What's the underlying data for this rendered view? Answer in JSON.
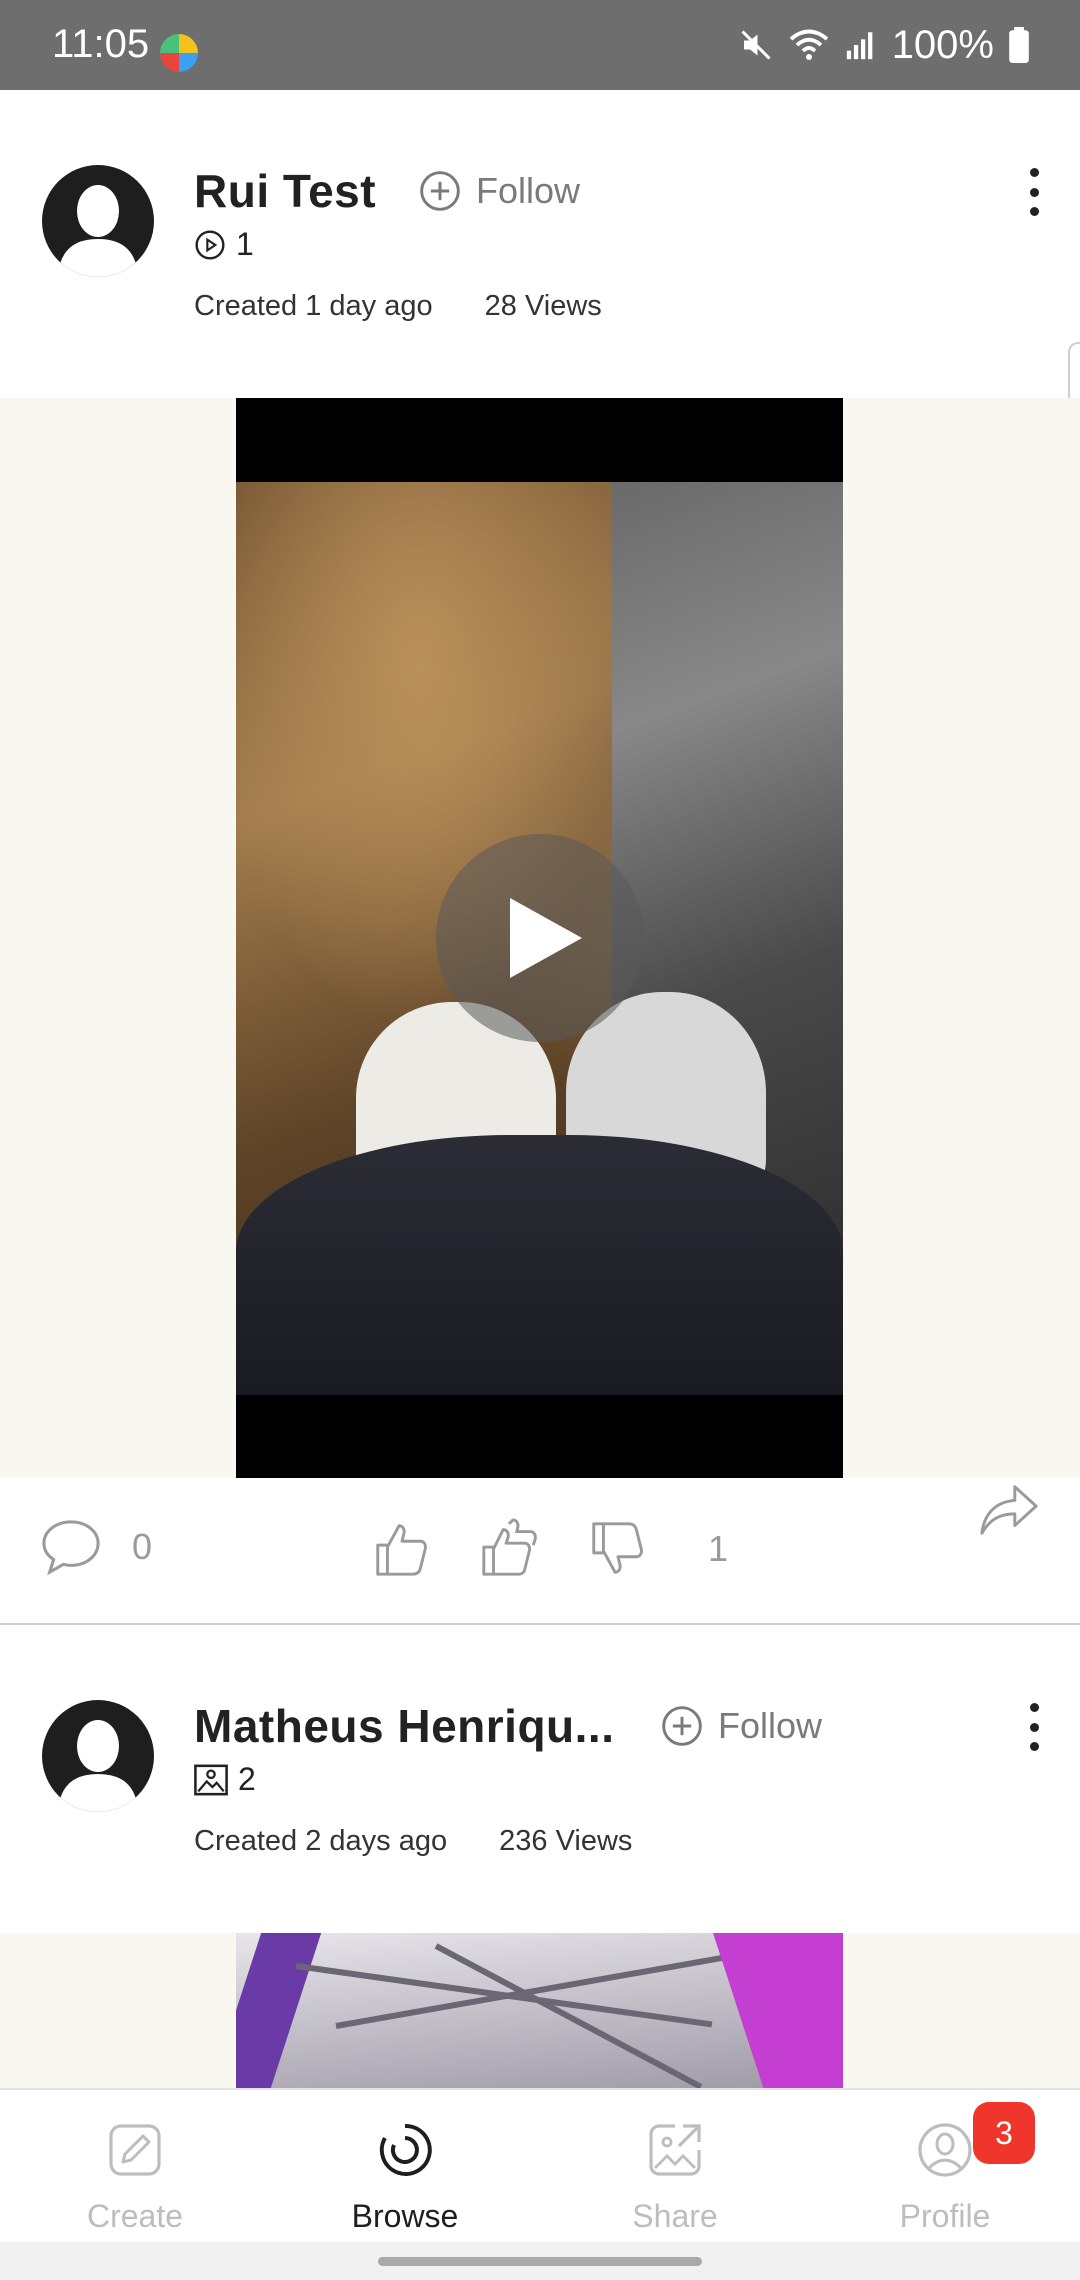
{
  "status_bar": {
    "time": "11:05",
    "battery": "100%",
    "icons": [
      "app-icon",
      "mute-icon",
      "wifi-icon",
      "signal-icon",
      "battery-icon"
    ]
  },
  "posts": [
    {
      "author": "Rui Test",
      "follow_label": "Follow",
      "media_type_icon": "play-circle-icon",
      "media_count": "1",
      "created": "Created 1 day ago",
      "views": "28 Views",
      "comments": "0",
      "reactions": "1"
    },
    {
      "author": "Matheus Henriqu...",
      "follow_label": "Follow",
      "media_type_icon": "image-icon",
      "media_count": "2",
      "created": "Created 2 days ago",
      "views": "236 Views"
    }
  ],
  "bottom_nav": {
    "items": [
      {
        "label": "Create",
        "icon": "pen-icon",
        "active": false
      },
      {
        "label": "Browse",
        "icon": "browse-icon",
        "active": true
      },
      {
        "label": "Share",
        "icon": "share-image-icon",
        "active": false
      },
      {
        "label": "Profile",
        "icon": "profile-icon",
        "active": false
      }
    ],
    "profile_badge": "3"
  },
  "colors": {
    "status_bar": "#6e6e6e",
    "media_background": "#f8f7f0",
    "badge": "#f0352c",
    "active_label": "#1e1e1e",
    "inactive_label": "#bdbdbd"
  }
}
